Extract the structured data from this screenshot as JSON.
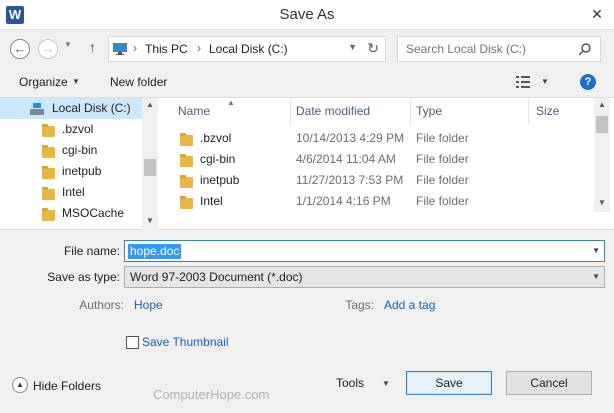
{
  "window": {
    "title": "Save As",
    "app_icon": "W",
    "close_glyph": "✕"
  },
  "nav": {
    "path": [
      "This PC",
      "Local Disk (C:)"
    ],
    "search_placeholder": "Search Local Disk (C:)"
  },
  "toolbar": {
    "organize": "Organize",
    "new_folder": "New folder",
    "help": "?"
  },
  "tree": {
    "items": [
      {
        "label": "Local Disk (C:)",
        "selected": true
      },
      {
        "label": ".bzvol"
      },
      {
        "label": "cgi-bin"
      },
      {
        "label": "inetpub"
      },
      {
        "label": "Intel"
      },
      {
        "label": "MSOCache"
      }
    ]
  },
  "list": {
    "columns": [
      "Name",
      "Date modified",
      "Type",
      "Size"
    ],
    "rows": [
      {
        "name": ".bzvol",
        "date": "10/14/2013 4:29 PM",
        "type": "File folder"
      },
      {
        "name": "cgi-bin",
        "date": "4/6/2014 11:04 AM",
        "type": "File folder"
      },
      {
        "name": "inetpub",
        "date": "11/27/2013 7:53 PM",
        "type": "File folder"
      },
      {
        "name": "Intel",
        "date": "1/1/2014 4:16 PM",
        "type": "File folder"
      }
    ]
  },
  "form": {
    "file_name_label": "File name:",
    "file_name_value": "hope.doc",
    "save_type_label": "Save as type:",
    "save_type_value": "Word 97-2003 Document (*.doc)",
    "authors_label": "Authors:",
    "authors_value": "Hope",
    "tags_label": "Tags:",
    "tags_value": "Add a tag",
    "thumbnail_label": "Save Thumbnail",
    "thumbnail_checked": false
  },
  "footer": {
    "hide_folders": "Hide Folders",
    "tools": "Tools",
    "save": "Save",
    "cancel": "Cancel",
    "watermark": "ComputerHope.com"
  },
  "colors": {
    "accent": "#3399ff",
    "link": "#1a5fb4",
    "selection": "#cce8ff",
    "folder": "#e9b640"
  }
}
